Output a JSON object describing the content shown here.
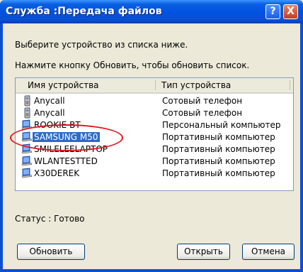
{
  "window": {
    "title": "Служба :Передача файлов"
  },
  "titlebar_buttons": {
    "help": "?",
    "close": "X"
  },
  "instructions": {
    "line1": "Выберите устройство из списка ниже.",
    "line2": "Нажмите кнопку Обновить, чтобы обновить список."
  },
  "table": {
    "columns": [
      "Имя устройства",
      "Тип устройства"
    ],
    "rows": [
      {
        "name": "Anycall",
        "type": "Сотовый телефон",
        "icon": "phone-icon"
      },
      {
        "name": "Anycall",
        "type": "Сотовый телефон",
        "icon": "phone-icon"
      },
      {
        "name": "ROOKIE-BT",
        "type": "Персональный компьютер",
        "icon": "laptop-icon"
      },
      {
        "name": "SAMSUNG M50",
        "type": "Портативный компьютер",
        "icon": "laptop-icon",
        "selected": true
      },
      {
        "name": "SMILELEELAPTOP",
        "type": "Портативный компьютер",
        "icon": "laptop-icon"
      },
      {
        "name": "WLANTESTTED",
        "type": "Портативный компьютер",
        "icon": "laptop-icon"
      },
      {
        "name": "X30DEREK",
        "type": "Портативный компьютер",
        "icon": "laptop-icon"
      }
    ]
  },
  "status": "Статус : Готово",
  "buttons": {
    "refresh": "Обновить",
    "open": "Открыть",
    "cancel": "Отмена"
  },
  "colors": {
    "titlebar": "#0053e1",
    "selection": "#316ac5",
    "annotation": "#e0121a",
    "dialog_bg": "#ece9d8"
  }
}
